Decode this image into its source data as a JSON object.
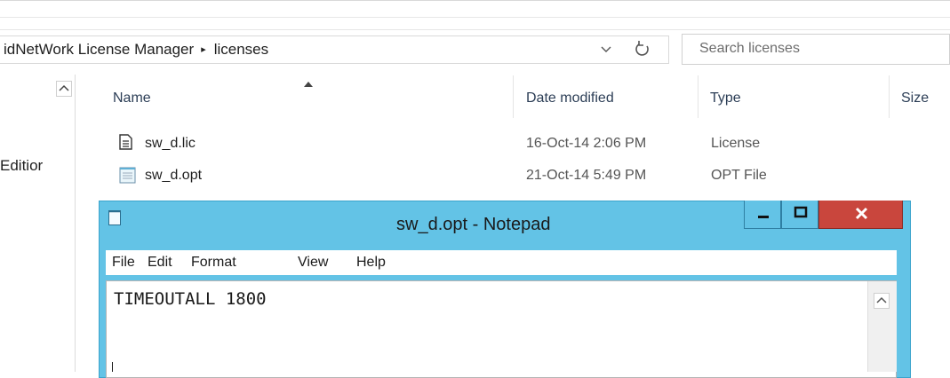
{
  "explorer": {
    "breadcrumb": {
      "parent": "idNetWork License Manager",
      "separator": "▸",
      "current": "licenses"
    },
    "search": {
      "placeholder": "Search licenses"
    },
    "nav": {
      "visible_item": "Editior"
    },
    "columns": {
      "name": "Name",
      "date_modified": "Date modified",
      "type": "Type",
      "size": "Size"
    },
    "files": [
      {
        "name": "sw_d.lic",
        "date": "16-Oct-14 2:06 PM",
        "type": "License",
        "icon": "document-icon"
      },
      {
        "name": "sw_d.opt",
        "date": "21-Oct-14 5:49 PM",
        "type": "OPT File",
        "icon": "notepad-file-icon"
      }
    ]
  },
  "notepad": {
    "title": "sw_d.opt - Notepad",
    "menu": [
      "File",
      "Edit",
      "Format",
      "View",
      "Help"
    ],
    "content": "TIMEOUTALL 1800",
    "accent": "#63c3e6",
    "close_color": "#c9463d"
  }
}
